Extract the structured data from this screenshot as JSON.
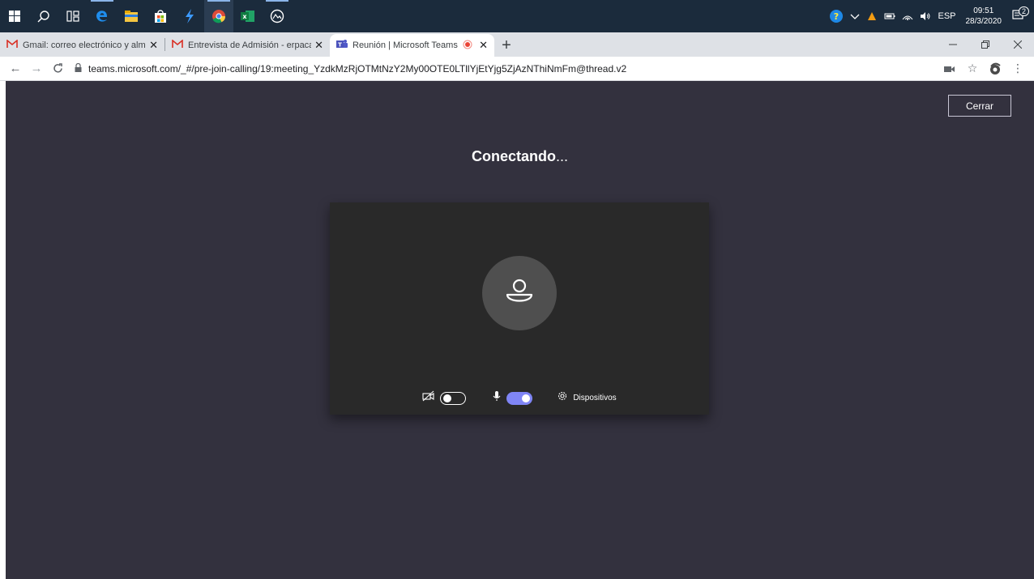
{
  "taskbar": {
    "icons": [
      "windows-start-icon",
      "search-icon",
      "task-view-icon",
      "edge-icon",
      "file-explorer-icon",
      "store-icon",
      "bolt-app-icon",
      "chrome-icon",
      "excel-icon",
      "camera-app-icon"
    ],
    "tray": {
      "language": "ESP",
      "time": "09:51",
      "date": "28/3/2020",
      "notifications_count": "2"
    }
  },
  "browser": {
    "tabs": [
      {
        "title": "Gmail: correo electrónico y almac",
        "icon": "gmail-icon",
        "active": false
      },
      {
        "title": "Entrevista de Admisión - erpacal",
        "icon": "gmail-icon",
        "active": false
      },
      {
        "title": "Reunión | Microsoft Teams",
        "icon": "teams-icon",
        "active": true
      }
    ],
    "new_tab_label": "+",
    "url": "teams.microsoft.com/_#/pre-join-calling/19:meeting_YzdkMzRjOTMtNzY2My00OTE0LTllYjEtYjg5ZjAzNThiNmFm@thread.v2"
  },
  "teams": {
    "close_label": "Cerrar",
    "status_text": "Conectando",
    "status_dots": "...",
    "camera_enabled": false,
    "mic_enabled": true,
    "devices_label": "Dispositivos",
    "accent": "#7f85f5",
    "background": "#33313e"
  }
}
